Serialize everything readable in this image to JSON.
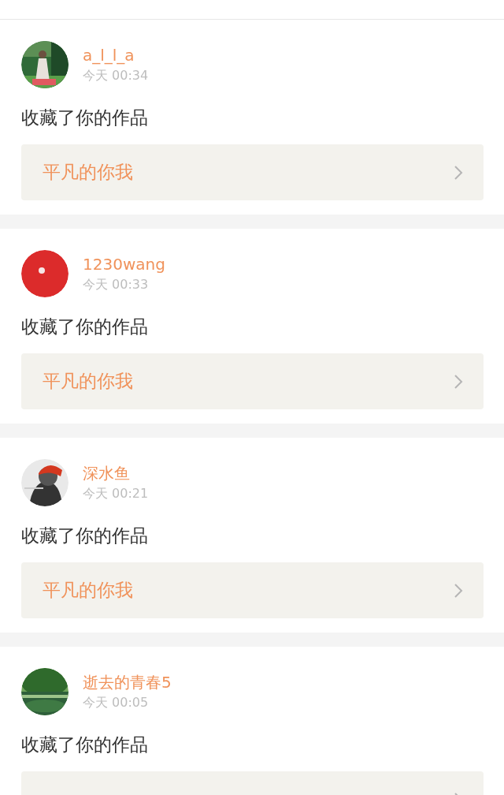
{
  "notifications": [
    {
      "username": "a_l_l_a",
      "time": "今天 00:34",
      "action": "收藏了你的作品",
      "work_title": "平凡的你我"
    },
    {
      "username": "1230wang",
      "time": "今天 00:33",
      "action": "收藏了你的作品",
      "work_title": "平凡的你我"
    },
    {
      "username": "深水鱼",
      "time": "今天 00:21",
      "action": "收藏了你的作品",
      "work_title": "平凡的你我"
    },
    {
      "username": "逝去的青春5",
      "time": "今天 00:05",
      "action": "收藏了你的作品"
    }
  ]
}
